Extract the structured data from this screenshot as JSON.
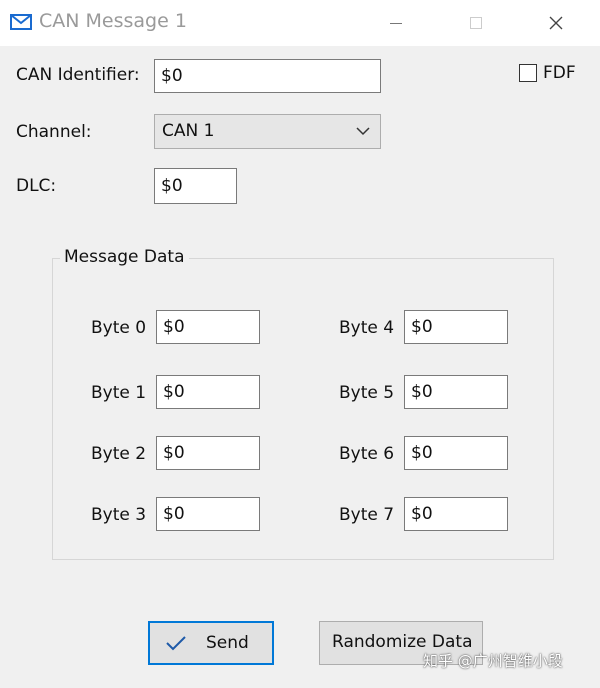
{
  "window": {
    "title": "CAN Message 1"
  },
  "form": {
    "can_identifier_label": "CAN Identifier:",
    "can_identifier_value": "$0",
    "fdf_label": "FDF",
    "fdf_checked": false,
    "channel_label": "Channel:",
    "channel_value": "CAN 1",
    "dlc_label": "DLC:",
    "dlc_value": "$0"
  },
  "message_data": {
    "title": "Message Data",
    "bytes": [
      {
        "label": "Byte 0",
        "value": "$0"
      },
      {
        "label": "Byte 1",
        "value": "$0"
      },
      {
        "label": "Byte 2",
        "value": "$0"
      },
      {
        "label": "Byte 3",
        "value": "$0"
      },
      {
        "label": "Byte 4",
        "value": "$0"
      },
      {
        "label": "Byte 5",
        "value": "$0"
      },
      {
        "label": "Byte 6",
        "value": "$0"
      },
      {
        "label": "Byte 7",
        "value": "$0"
      }
    ]
  },
  "buttons": {
    "send_label": "Send",
    "randomize_label": "Randomize Data"
  },
  "watermark": "知乎 @广州智维小段",
  "icons": {
    "title": "envelope-icon",
    "send": "checkmark-icon",
    "dropdown": "chevron-down-icon"
  },
  "colors": {
    "accent": "#0078d7",
    "background": "#f0f0f0"
  }
}
